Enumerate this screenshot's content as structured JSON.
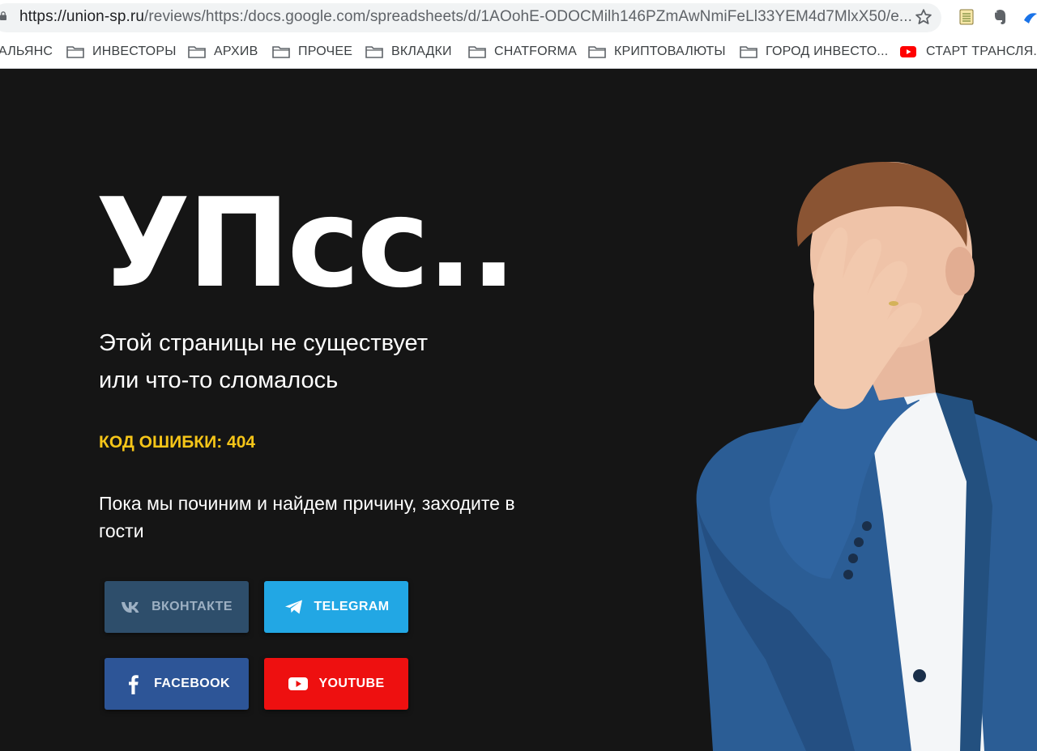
{
  "browser": {
    "url_host": "https://union-sp.ru",
    "url_path": "/reviews/https:/docs.google.com/spreadsheets/d/1AOohE-ODOCMilh146PZmAwNmiFeLl33YEM4d7MlxX50/e..."
  },
  "bookmarks": [
    {
      "label": "АЛЬЯНС",
      "icon": "none"
    },
    {
      "label": "ИНВЕСТОРЫ",
      "icon": "folder-icon"
    },
    {
      "label": "АРХИВ",
      "icon": "folder-icon"
    },
    {
      "label": "ПРОЧЕЕ",
      "icon": "folder-icon"
    },
    {
      "label": "ВКЛАДКИ",
      "icon": "folder-icon"
    },
    {
      "label": "CHATFORMA",
      "icon": "folder-icon"
    },
    {
      "label": "КРИПТОВАЛЮТЫ",
      "icon": "folder-icon"
    },
    {
      "label": "ГОРОД ИНВЕСТО...",
      "icon": "folder-icon"
    },
    {
      "label": "СТАРТ ТРАНСЛЯ...",
      "icon": "youtube-icon"
    }
  ],
  "page": {
    "headline": "УПсс..",
    "subtitle_line1": "Этой страницы не существует",
    "subtitle_line2": "или что-то сломалось",
    "error_code": "КОД ОШИБКИ: 404",
    "message": "Пока мы починим и найдем причину, заходите в гости"
  },
  "social": {
    "vk": "ВКОНТАКТЕ",
    "telegram": "TELEGRAM",
    "facebook": "FACEBOOK",
    "youtube": "YOUTUBE"
  },
  "colors": {
    "background": "#151515",
    "accent_yellow": "#f5c518",
    "vk": "#2e4e6b",
    "telegram": "#22a7e4",
    "facebook": "#2d5597",
    "youtube": "#ee1010"
  }
}
